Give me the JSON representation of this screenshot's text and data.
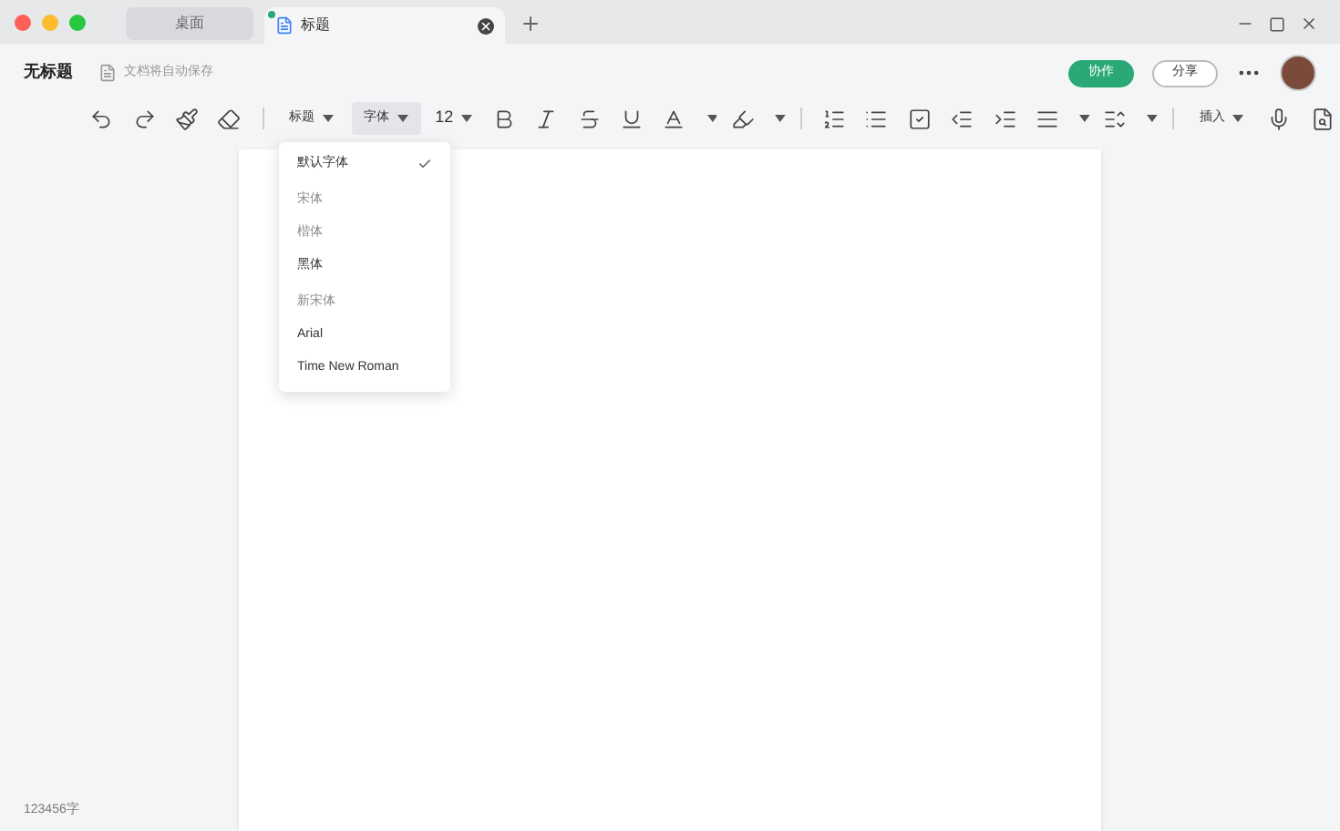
{
  "tabs": [
    {
      "label": "桌面",
      "selected": false
    },
    {
      "label": "标题",
      "selected": true
    }
  ],
  "header": {
    "title": "无标题",
    "save_status": "文档将自动保存",
    "buttons": [
      {
        "label": "协作",
        "kind": "primary"
      },
      {
        "label": "分享",
        "kind": "outline"
      }
    ]
  },
  "toolbar": {
    "heading": "标题",
    "font": {
      "label": "字体",
      "expanded": true
    },
    "size": "12",
    "insert": "插入"
  },
  "font_menu": [
    {
      "label": "默认字体",
      "checked": true,
      "kind": "sans"
    },
    {
      "label": "宋体",
      "checked": false,
      "kind": "serif"
    },
    {
      "label": "楷体",
      "checked": false,
      "kind": "serif"
    },
    {
      "label": "黑体",
      "checked": false,
      "kind": "sans"
    },
    {
      "label": "新宋体",
      "checked": false,
      "kind": "serif"
    },
    {
      "label": "Arial",
      "checked": false,
      "kind": "sans"
    },
    {
      "label": "Time New Roman",
      "checked": false,
      "kind": "sans"
    }
  ],
  "status_bar": {
    "word_count": "123456字"
  }
}
